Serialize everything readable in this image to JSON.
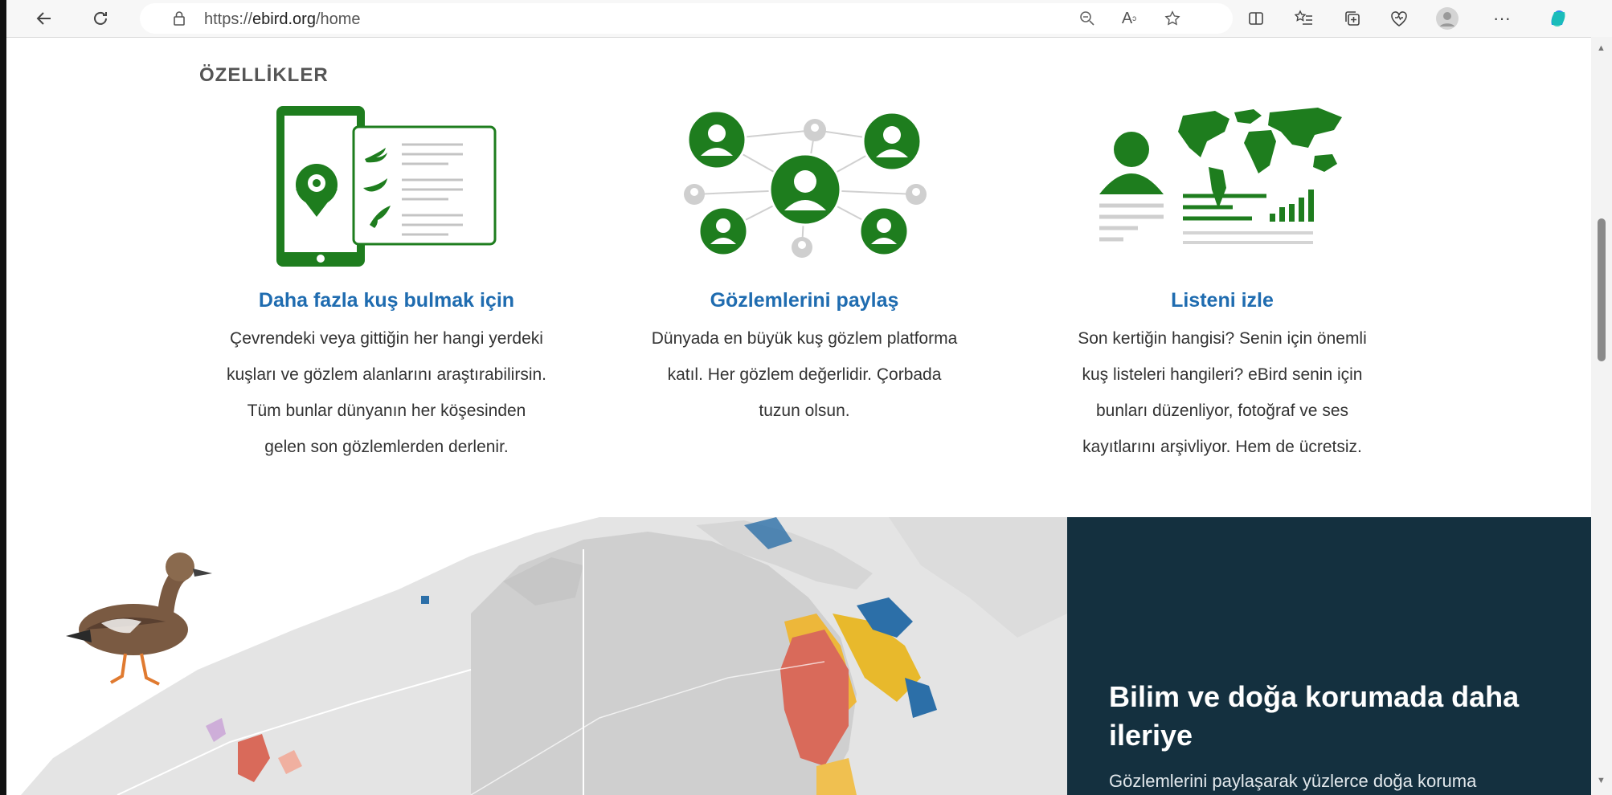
{
  "browser": {
    "url_prefix": "https://",
    "url_domain": "ebird.org",
    "url_path": "/home",
    "icons": [
      "back-icon",
      "refresh-icon",
      "lock-icon",
      "zoom-icon",
      "read-aloud-icon",
      "favorite-icon",
      "split-screen-icon",
      "favorites-list-icon",
      "collections-icon",
      "browser-essentials-icon",
      "profile-avatar",
      "more-icon",
      "copilot-icon"
    ]
  },
  "features": {
    "heading": "ÖZELLİKLER",
    "items": [
      {
        "title": "Daha fazla kuş bulmak için",
        "lines": [
          "Çevrendeki veya gittiğin her hangi yerdeki",
          "kuşları ve gözlem alanlarını araştırabilirsin.",
          "Tüm bunlar dünyanın her köşesinden",
          "gelen son gözlemlerden derlenir."
        ]
      },
      {
        "title": "Gözlemlerini paylaş",
        "lines": [
          "Dünyada en büyük kuş gözlem platforma",
          "katıl. Her gözlem değerlidir. Çorbada",
          "tuzun olsun."
        ]
      },
      {
        "title": "Listeni izle",
        "lines": [
          "Son kertiğin hangisi? Senin için önemli",
          "kuş listeleri hangileri? eBird senin için",
          "bunları düzenliyor, fotoğraf ve ses",
          "kayıtlarını arşivliyor. Hem de ücretsiz."
        ]
      }
    ]
  },
  "science_panel": {
    "title": "Bilim ve doğa korumada daha ileriye",
    "text": "Gözlemlerini paylaşarak yüzlerce doğa koruma"
  },
  "colors": {
    "brand_green": "#1e7d1e",
    "link_blue": "#1f6cb0",
    "panel_navy": "#14303f"
  }
}
